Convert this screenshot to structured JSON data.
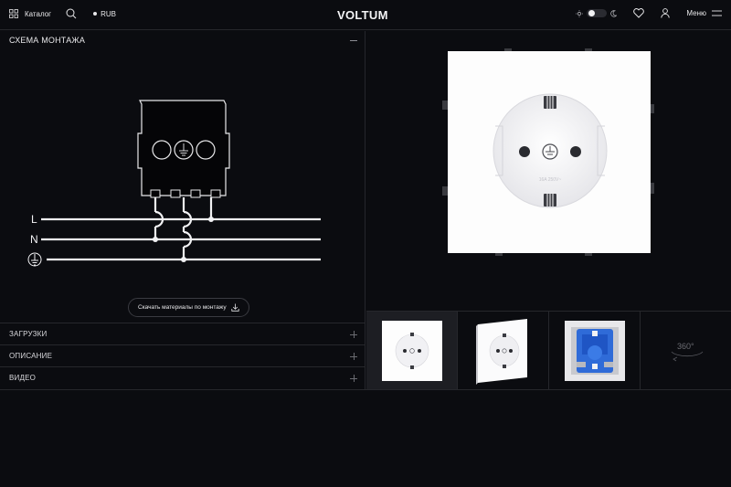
{
  "header": {
    "catalog_label": "Каталог",
    "currency_label": "RUB",
    "logo": "VOLTUM",
    "menu_label": "Меню"
  },
  "mounting": {
    "title": "СХЕМА МОНТАЖА",
    "wire_labels": [
      "L",
      "N"
    ],
    "download_label": "Скачать материалы по монтажу"
  },
  "accordion": [
    {
      "label": "ЗАГРУЗКИ"
    },
    {
      "label": "ОПИСАНИЕ"
    },
    {
      "label": "ВИДЕО"
    }
  ],
  "gallery": {
    "rotate_label": "360°",
    "socket_label": "16A 250V~"
  },
  "colors": {
    "background": "#0b0c10",
    "divider": "#26272c",
    "accent_mechanism": "#2f6bd8"
  }
}
